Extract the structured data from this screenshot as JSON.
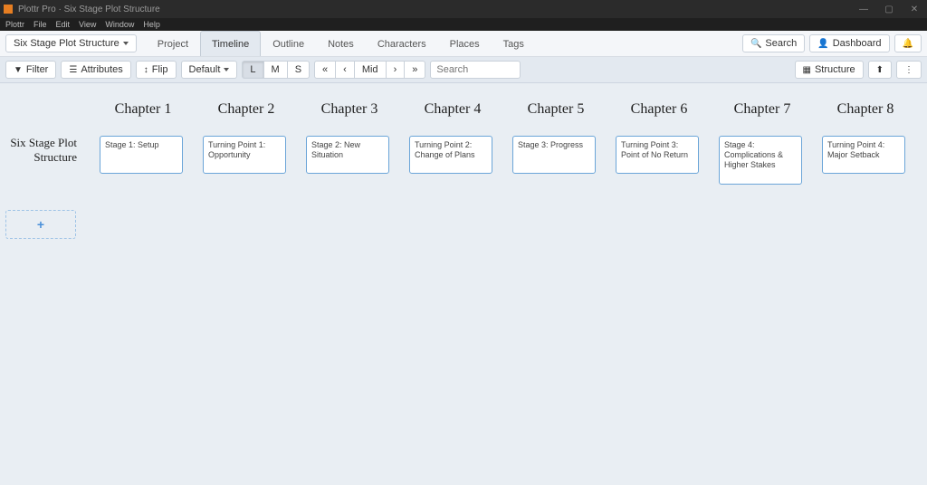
{
  "window": {
    "app": "Plottr Pro",
    "doc": "Six Stage Plot Structure"
  },
  "menu": [
    "Plottr",
    "File",
    "Edit",
    "View",
    "Window",
    "Help"
  ],
  "book_dropdown": "Six Stage Plot Structure",
  "tabs": [
    "Project",
    "Timeline",
    "Outline",
    "Notes",
    "Characters",
    "Places",
    "Tags"
  ],
  "active_tab": "Timeline",
  "top_right": {
    "search": "Search",
    "dashboard": "Dashboard"
  },
  "toolbar": {
    "filter": "Filter",
    "attributes": "Attributes",
    "flip": "Flip",
    "default": "Default",
    "zoom": [
      "L",
      "M",
      "S"
    ],
    "nav": [
      "«",
      "‹",
      "Mid",
      "›",
      "»"
    ],
    "search_placeholder": "Search",
    "structure": "Structure"
  },
  "chapters": [
    "Chapter 1",
    "Chapter 2",
    "Chapter 3",
    "Chapter 4",
    "Chapter 5",
    "Chapter 6",
    "Chapter 7",
    "Chapter 8"
  ],
  "plotline": "Six Stage Plot Structure",
  "cards": [
    "Stage 1: Setup",
    "Turning Point 1: Opportunity",
    "Stage 2: New Situation",
    "Turning Point 2: Change of Plans",
    "Stage 3: Progress",
    "Turning Point 3: Point of No Return",
    "Stage 4: Complications & Higher Stakes",
    "Turning Point 4: Major Setback"
  ],
  "add": "+"
}
